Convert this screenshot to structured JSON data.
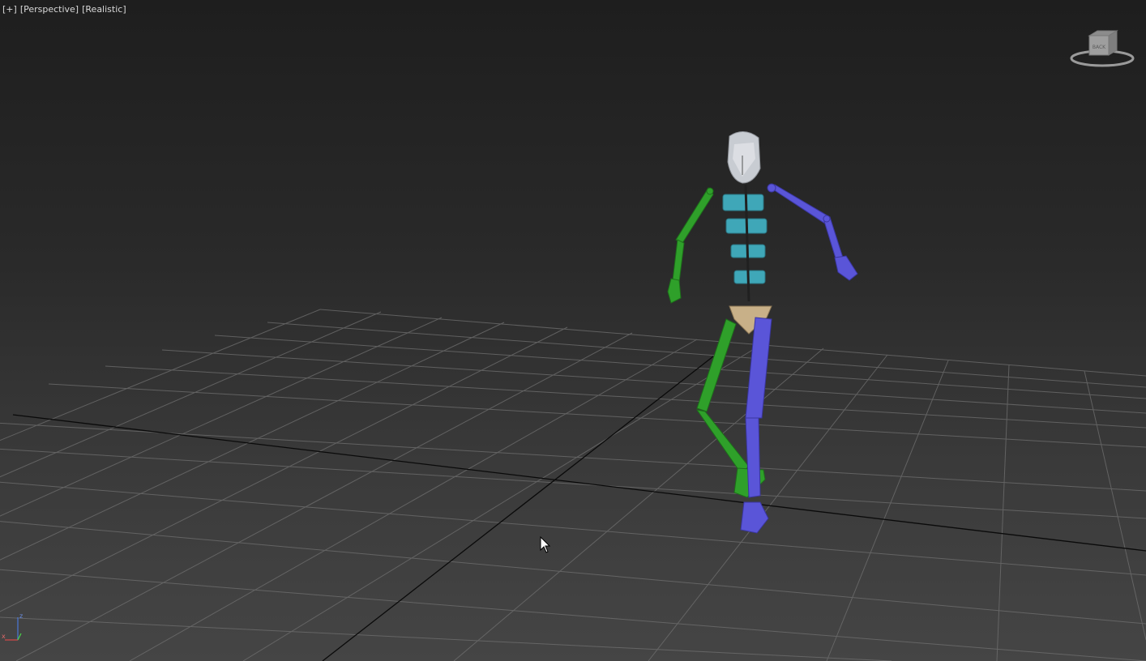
{
  "viewport": {
    "labels": [
      "[+]",
      "[Perspective]",
      "[Realistic]"
    ],
    "viewcube": {
      "face_label": "BACK"
    },
    "axis": {
      "z": "z",
      "x": "x"
    }
  },
  "colors": {
    "left_limbs": "#2fa02a",
    "right_limbs": "#5a55d8",
    "spine": "#3fa7b8",
    "pelvis": "#c8b088",
    "head": "#c8ccd2",
    "grid": "#6e6e6e",
    "axis_lines": "#000000"
  }
}
